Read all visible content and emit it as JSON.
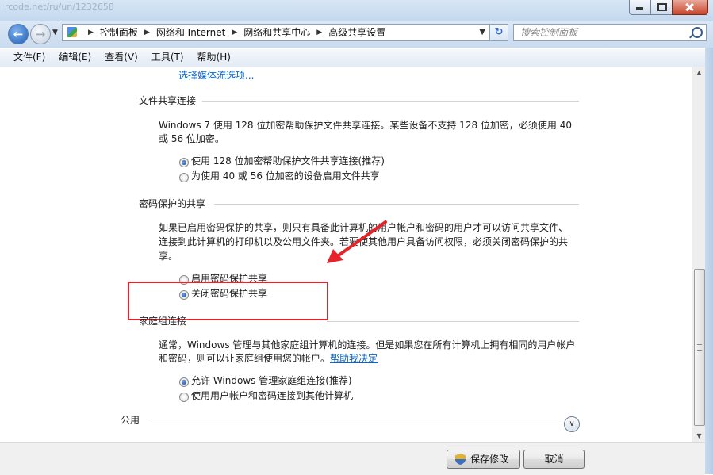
{
  "titlebar": {
    "ghost_text": "rcode.net/ru/un/1232658"
  },
  "nav": {
    "breadcrumbs": [
      "控制面板",
      "网络和 Internet",
      "网络和共享中心",
      "高级共享设置"
    ],
    "search_placeholder": "搜索控制面板"
  },
  "menu": [
    "文件(F)",
    "编辑(E)",
    "查看(V)",
    "工具(T)",
    "帮助(H)"
  ],
  "content": {
    "media_link": "选择媒体流选项...",
    "file_sharing": {
      "title": "文件共享连接",
      "desc_line1": "Windows 7 使用 128 位加密帮助保护文件共享连接。某些设备不支持 128 位加密，必须使用 40",
      "desc_line2": "或 56 位加密。",
      "options": [
        {
          "label": "使用 128 位加密帮助保护文件共享连接(推荐)",
          "checked": true
        },
        {
          "label": "为使用 40 或 56 位加密的设备启用文件共享",
          "checked": false
        }
      ]
    },
    "password_sharing": {
      "title": "密码保护的共享",
      "desc_line1": "如果已启用密码保护的共享，则只有具备此计算机的用户帐户和密码的用户才可以访问共享文件、",
      "desc_line2": "连接到此计算机的打印机以及公用文件夹。若要使其他用户具备访问权限，必须关闭密码保护的共",
      "desc_line3": "享。",
      "options": [
        {
          "label": "启用密码保护共享",
          "checked": false
        },
        {
          "label": "关闭密码保护共享",
          "checked": true
        }
      ]
    },
    "homegroup": {
      "title": "家庭组连接",
      "desc_line1": "通常，Windows 管理与其他家庭组计算机的连接。但是如果您在所有计算机上拥有相同的用户帐户",
      "desc_line2_prefix": "和密码，则可以让家庭组使用您的帐户。",
      "help_link": "帮助我决定",
      "options": [
        {
          "label": "允许 Windows 管理家庭组连接(推荐)",
          "checked": true
        },
        {
          "label": "使用用户帐户和密码连接到其他计算机",
          "checked": false
        }
      ]
    },
    "public_section": "公用"
  },
  "buttons": {
    "save": "保存修改",
    "cancel": "取消"
  },
  "colors": {
    "highlight_box": "#e3252b",
    "link": "#0a64c8",
    "accent": "#1e5fb8"
  }
}
